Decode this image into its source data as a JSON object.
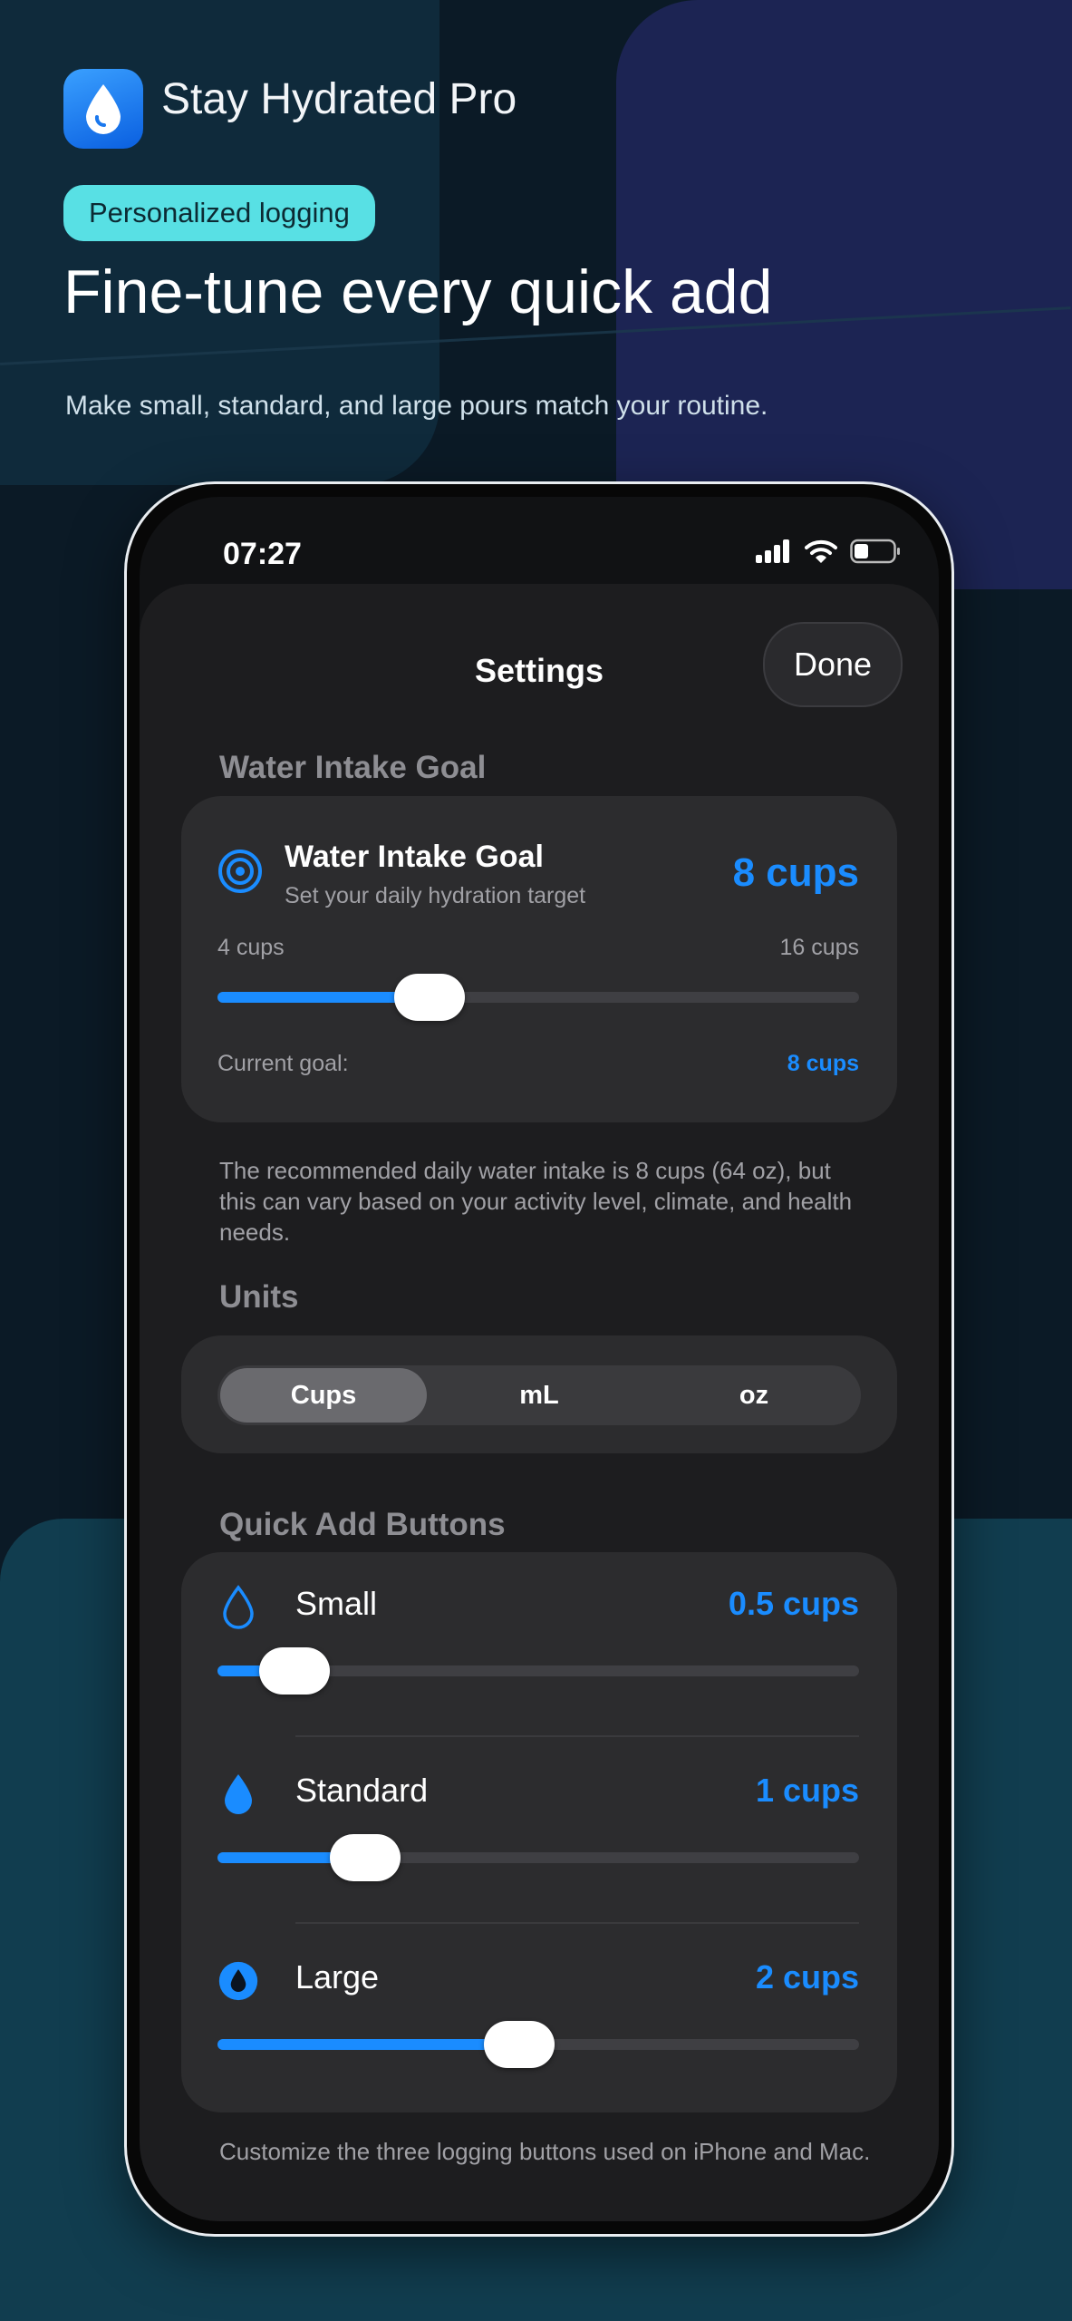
{
  "header": {
    "app_name": "Stay Hydrated Pro",
    "pill": "Personalized logging",
    "headline": "Fine-tune every quick add",
    "subline": "Make small, standard, and large pours match your routine."
  },
  "status_bar": {
    "time": "07:27"
  },
  "settings": {
    "title": "Settings",
    "done": "Done",
    "goal_section": "Water Intake Goal",
    "goal": {
      "title": "Water Intake Goal",
      "subtitle": "Set your daily hydration target",
      "value": "8 cups",
      "min_label": "4 cups",
      "max_label": "16 cups",
      "slider_fraction": 0.33,
      "current_label": "Current goal:",
      "current_value": "8 cups"
    },
    "goal_note": "The recommended daily water intake is 8 cups (64 oz), but this can vary based on your activity level, climate, and health needs.",
    "units_section": "Units",
    "units": {
      "options": [
        "Cups",
        "mL",
        "oz"
      ],
      "selected": "Cups"
    },
    "quick_section": "Quick Add Buttons",
    "quick": [
      {
        "label": "Small",
        "value": "0.5 cups",
        "slider_fraction": 0.12,
        "icon": "droplet-outline-icon"
      },
      {
        "label": "Standard",
        "value": "1 cups",
        "slider_fraction": 0.23,
        "icon": "droplet-filled-icon"
      },
      {
        "label": "Large",
        "value": "2 cups",
        "slider_fraction": 0.47,
        "icon": "droplet-circle-icon"
      }
    ],
    "quick_note": "Customize the three logging buttons used on iPhone and Mac."
  },
  "colors": {
    "accent": "#1a8cff",
    "pill": "#58e0e4",
    "card": "#2c2c2e"
  }
}
